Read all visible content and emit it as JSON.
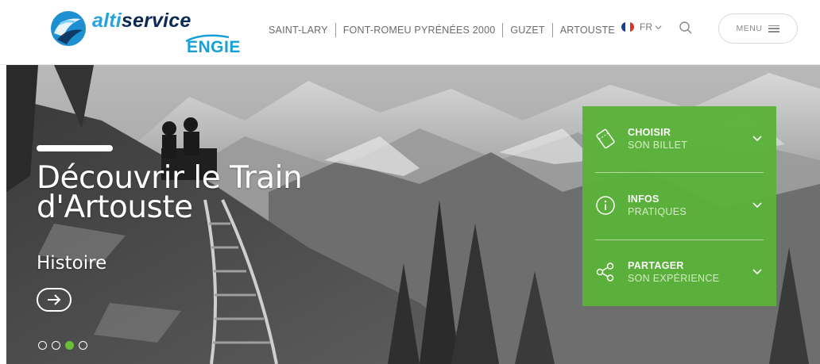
{
  "brand": {
    "name_prefix": "alti",
    "name_suffix": "service",
    "sub_brand": "ENGIE",
    "colors": {
      "navy": "#0d2a55",
      "blue": "#27a3de",
      "green": "#5bb33a"
    }
  },
  "nav": {
    "links": [
      {
        "label": "SAINT-LARY"
      },
      {
        "label": "FONT-ROMEU PYRÉNÉES 2000"
      },
      {
        "label": "GUZET"
      },
      {
        "label": "ARTOUSTE"
      }
    ]
  },
  "language": {
    "code": "FR",
    "flag_colors": [
      "#1f3b8f",
      "#ffffff",
      "#e0302a"
    ]
  },
  "search": {
    "icon": "search-icon"
  },
  "menu": {
    "label": "MENU",
    "icon": "hamburger-icon"
  },
  "hero": {
    "title": "Découvrir le Train d'Artouste",
    "subtitle": "Histoire",
    "cta_icon": "arrow-right-icon",
    "slides": {
      "count": 4,
      "active_index": 2
    }
  },
  "panel": {
    "items": [
      {
        "title": "CHOISIR",
        "subtitle": "SON BILLET",
        "icon": "ticket-icon"
      },
      {
        "title": "INFOS",
        "subtitle": "PRATIQUES",
        "icon": "info-icon"
      },
      {
        "title": "PARTAGER",
        "subtitle": "SON EXPÉRIENCE",
        "icon": "share-icon"
      }
    ]
  }
}
